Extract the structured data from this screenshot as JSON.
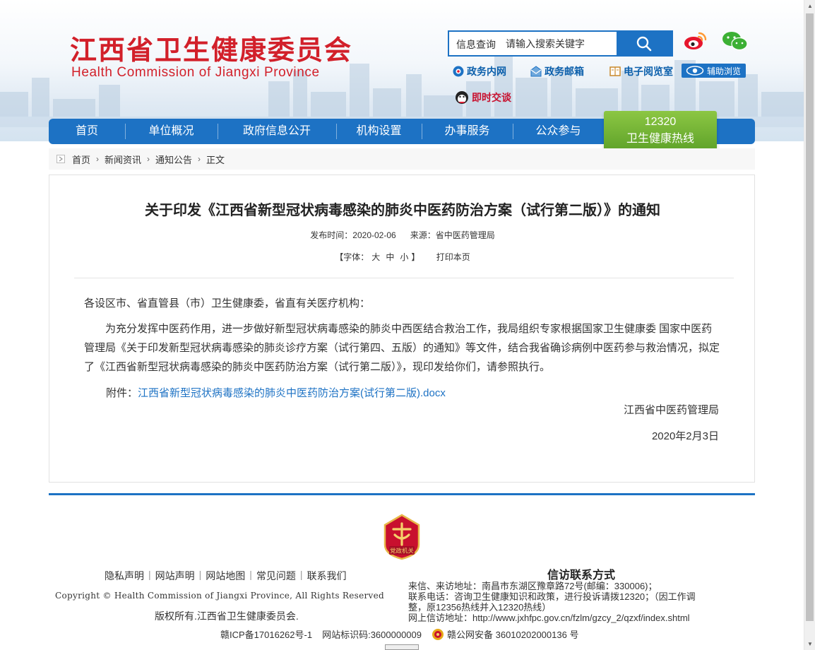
{
  "header": {
    "logo_cn": "江西省卫生健康委员会",
    "logo_en": "Health Commission of Jiangxi Province",
    "search": {
      "label": "信息查询",
      "placeholder": "请输入搜索关键字"
    },
    "social": [
      "weibo-icon",
      "wechat-icon"
    ],
    "quick_links": [
      {
        "label": "政务内网",
        "icon": "intranet-icon"
      },
      {
        "label": "政务邮箱",
        "icon": "mail-icon"
      },
      {
        "label": "电子阅览室",
        "icon": "book-icon"
      },
      {
        "label": "即时交谈",
        "icon": "chat-icon"
      }
    ],
    "assist_label": "辅助浏览"
  },
  "nav": {
    "items": [
      "首页",
      "单位概况",
      "政府信息公开",
      "机构设置",
      "办事服务",
      "公众参与"
    ],
    "hotline_number": "12320",
    "hotline_label": "卫生健康热线"
  },
  "breadcrumb": [
    "首页",
    "新闻资讯",
    "通知公告",
    "正文"
  ],
  "article": {
    "title": "关于印发《江西省新型冠状病毒感染的肺炎中医药防治方案（试行第二版）》的通知",
    "publish_time": "发布时间：2020-02-06",
    "source": "来源：省中医药管理局",
    "font_prefix": "【字体：",
    "font_large": "大",
    "font_medium": "中",
    "font_small": "小",
    "font_suffix": "】",
    "print_label": "打印本页",
    "salutation": "各设区市、省直管县（市）卫生健康委，省直有关医疗机构：",
    "paragraph": "为充分发挥中医药作用，进一步做好新型冠状病毒感染的肺炎中西医结合救治工作，我局组织专家根据国家卫生健康委 国家中医药管理局《关于印发新型冠状病毒感染的肺炎诊疗方案（试行第四、五版）的通知》等文件，结合我省确诊病例中医药参与救治情况，拟定了《江西省新型冠状病毒感染的肺炎中医药防治方案（试行第二版）》，现印发给你们，请参照执行。",
    "attachment_label": "附件：",
    "attachment_link": "江西省新型冠状病毒感染的肺炎中医药防治方案(试行第二版).docx",
    "signature": "江西省中医药管理局",
    "date": "2020年2月3日"
  },
  "footer": {
    "badge_text": "党政机关",
    "links": [
      "隐私声明",
      "网站声明",
      "网站地图",
      "常见问题",
      "联系我们"
    ],
    "copyright": "Copyright © Health Commission of Jiangxi Province, All Rights Reserved",
    "rights": "版权所有.江西省卫生健康委员会.",
    "icp": "赣ICP备17016262号-1",
    "site_code": "网站标识码:3600000009",
    "police": "赣公网安备 36010202000136 号",
    "xinfang_title": "信访联系方式",
    "xinfang_address": "来信、来访地址：南昌市东湖区豫章路72号(邮编：330006)；",
    "xinfang_phone_1": "联系电话：咨询卫生健康知识和政策，进行投诉请拨12320；（因工作调",
    "xinfang_phone_2": "整，原12356热线并入12320热线）",
    "xinfang_web": "网上信访地址：http://www.jxhfpc.gov.cn/fzlm/gzcy_2/qzxf/index.shtml"
  },
  "colors": {
    "brand_red": "#d2202a",
    "nav_blue": "#1d72c4",
    "hotline_green": "#6fb033"
  }
}
